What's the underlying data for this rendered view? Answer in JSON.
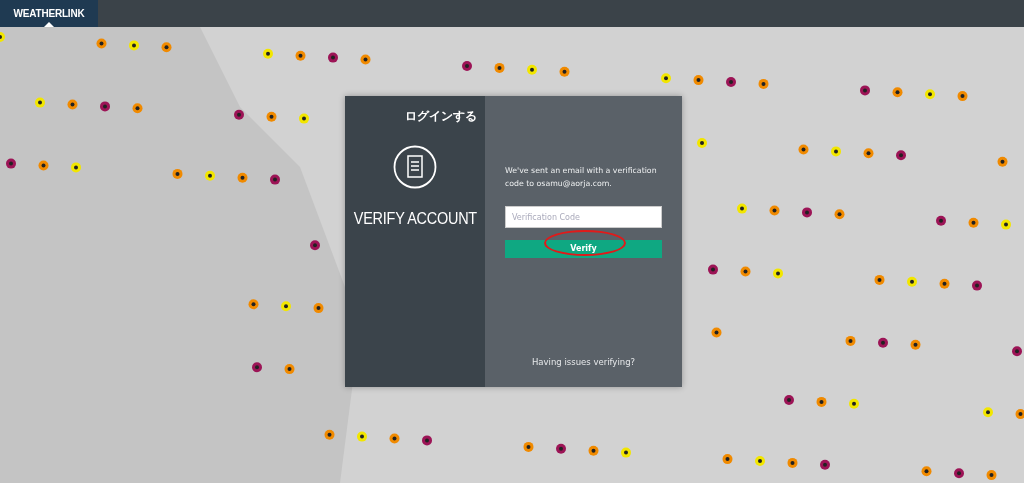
{
  "header": {
    "brand": "WEATHERLINK"
  },
  "modal": {
    "login_link": "ログインする",
    "title": "VERIFY ACCOUNT",
    "message": "We've sent an email with a verification code to osamu@aorja.com.",
    "code_field": {
      "placeholder": "Verification Code"
    },
    "verify_button": "Verify",
    "help_link": "Having issues verifying?"
  }
}
